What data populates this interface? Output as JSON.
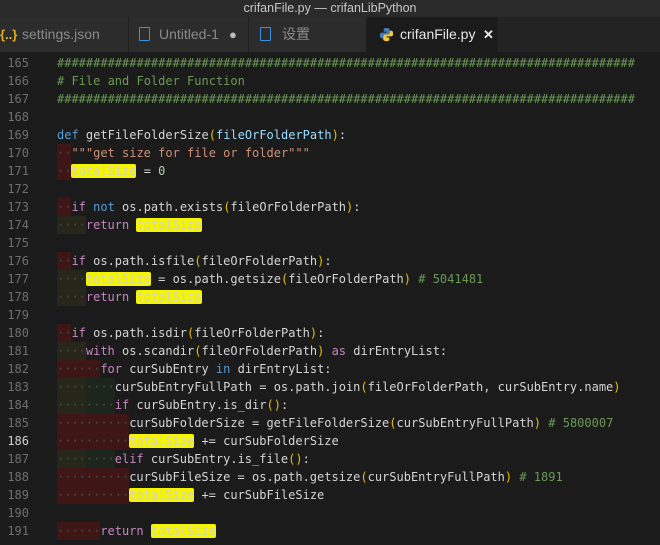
{
  "window": {
    "title": "crifanFile.py — crifanLibPython"
  },
  "tabs": [
    {
      "label": "settings.json",
      "icon": "json-braces-icon",
      "active": false
    },
    {
      "label": "Untitled-1",
      "icon": "file-icon",
      "active": false,
      "dirty": true,
      "dirty_glyph": "●"
    },
    {
      "label": "设置",
      "icon": "file-icon",
      "active": false
    },
    {
      "label": "crifanFile.py",
      "icon": "python-icon",
      "active": true,
      "close_glyph": "✕"
    }
  ],
  "colors": {
    "highlight": "#f5f500",
    "keyword": "#569cd6",
    "control": "#c586c0",
    "comment": "#6a9955",
    "string": "#ce9178",
    "indent_error": "#3e1616"
  },
  "editor": {
    "current_line": 186,
    "lines": [
      {
        "no": 165,
        "indent": [],
        "tokens": [
          [
            "c",
            "################################################################################"
          ]
        ]
      },
      {
        "no": 166,
        "indent": [],
        "tokens": [
          [
            "c",
            "# File and Folder Function"
          ]
        ]
      },
      {
        "no": 167,
        "indent": [],
        "tokens": [
          [
            "c",
            "################################################################################"
          ]
        ]
      },
      {
        "no": 168,
        "indent": [],
        "tokens": []
      },
      {
        "no": 169,
        "indent": [],
        "tokens": [
          [
            "kw",
            "def"
          ],
          [
            "t",
            " "
          ],
          [
            "fn",
            "getFileFolderSize"
          ],
          [
            "p",
            "("
          ],
          [
            "var",
            "fileOrFolderPath"
          ],
          [
            "p",
            ")"
          ],
          [
            "t",
            ":"
          ]
        ]
      },
      {
        "no": 170,
        "indent": [
          [
            "err",
            2
          ]
        ],
        "tokens": [
          [
            "s",
            "\"\"\"get size for file or folder\"\"\""
          ]
        ]
      },
      {
        "no": 171,
        "indent": [
          [
            "err",
            2
          ]
        ],
        "tokens": [
          [
            "hl",
            "totalSize"
          ],
          [
            "t",
            " = "
          ],
          [
            "n",
            "0"
          ]
        ]
      },
      {
        "no": 172,
        "indent": [],
        "tokens": []
      },
      {
        "no": 173,
        "indent": [
          [
            "err",
            2
          ]
        ],
        "tokens": [
          [
            "ctl",
            "if"
          ],
          [
            "t",
            " "
          ],
          [
            "kw",
            "not"
          ],
          [
            "t",
            " os.path.exists"
          ],
          [
            "p",
            "("
          ],
          [
            "t",
            "fileOrFolderPath"
          ],
          [
            "p",
            ")"
          ],
          [
            "t",
            ":"
          ]
        ]
      },
      {
        "no": 174,
        "indent": [
          [
            "l1",
            4
          ]
        ],
        "tokens": [
          [
            "ctl",
            "return"
          ],
          [
            "t",
            " "
          ],
          [
            "hl",
            "totalSize"
          ]
        ]
      },
      {
        "no": 175,
        "indent": [],
        "tokens": []
      },
      {
        "no": 176,
        "indent": [
          [
            "err",
            2
          ]
        ],
        "tokens": [
          [
            "ctl",
            "if"
          ],
          [
            "t",
            " os.path.isfile"
          ],
          [
            "p",
            "("
          ],
          [
            "t",
            "fileOrFolderPath"
          ],
          [
            "p",
            ")"
          ],
          [
            "t",
            ":"
          ]
        ]
      },
      {
        "no": 177,
        "indent": [
          [
            "l1",
            4
          ]
        ],
        "tokens": [
          [
            "hl",
            "totalSize"
          ],
          [
            "t",
            " = os.path.getsize"
          ],
          [
            "p",
            "("
          ],
          [
            "t",
            "fileOrFolderPath"
          ],
          [
            "p",
            ")"
          ],
          [
            "t",
            " "
          ],
          [
            "c",
            "# 5041481"
          ]
        ]
      },
      {
        "no": 178,
        "indent": [
          [
            "l1",
            4
          ]
        ],
        "tokens": [
          [
            "ctl",
            "return"
          ],
          [
            "t",
            " "
          ],
          [
            "hl",
            "totalSize"
          ]
        ]
      },
      {
        "no": 179,
        "indent": [],
        "tokens": []
      },
      {
        "no": 180,
        "indent": [
          [
            "err",
            2
          ]
        ],
        "tokens": [
          [
            "ctl",
            "if"
          ],
          [
            "t",
            " os.path.isdir"
          ],
          [
            "p",
            "("
          ],
          [
            "t",
            "fileOrFolderPath"
          ],
          [
            "p",
            ")"
          ],
          [
            "t",
            ":"
          ]
        ]
      },
      {
        "no": 181,
        "indent": [
          [
            "l1",
            4
          ]
        ],
        "tokens": [
          [
            "ctl",
            "with"
          ],
          [
            "t",
            " os.scandir"
          ],
          [
            "p",
            "("
          ],
          [
            "t",
            "fileOrFolderPath"
          ],
          [
            "p",
            ")"
          ],
          [
            "t",
            " "
          ],
          [
            "ctl",
            "as"
          ],
          [
            "t",
            " dirEntryList:"
          ]
        ]
      },
      {
        "no": 182,
        "indent": [
          [
            "err",
            6
          ]
        ],
        "tokens": [
          [
            "ctl",
            "for"
          ],
          [
            "t",
            " curSubEntry "
          ],
          [
            "kw",
            "in"
          ],
          [
            "t",
            " dirEntryList:"
          ]
        ]
      },
      {
        "no": 183,
        "indent": [
          [
            "l1",
            4
          ],
          [
            "l2",
            4
          ]
        ],
        "tokens": [
          [
            "t",
            "curSubEntryFullPath = os.path.join"
          ],
          [
            "p",
            "("
          ],
          [
            "t",
            "fileOrFolderPath, curSubEntry.name"
          ],
          [
            "p",
            ")"
          ]
        ]
      },
      {
        "no": 184,
        "indent": [
          [
            "l1",
            4
          ],
          [
            "l2",
            4
          ]
        ],
        "tokens": [
          [
            "ctl",
            "if"
          ],
          [
            "t",
            " curSubEntry.is_dir"
          ],
          [
            "p",
            "()"
          ],
          [
            "t",
            ":"
          ]
        ]
      },
      {
        "no": 185,
        "indent": [
          [
            "err",
            10
          ]
        ],
        "tokens": [
          [
            "t",
            "curSubFolderSize = getFileFolderSize"
          ],
          [
            "p",
            "("
          ],
          [
            "t",
            "curSubEntryFullPath"
          ],
          [
            "p",
            ")"
          ],
          [
            "t",
            " "
          ],
          [
            "c",
            "# 5800007"
          ]
        ]
      },
      {
        "no": 186,
        "indent": [
          [
            "err",
            10
          ]
        ],
        "tokens": [
          [
            "hl",
            "totalSize"
          ],
          [
            "t",
            " += curSubFolderSize"
          ]
        ]
      },
      {
        "no": 187,
        "indent": [
          [
            "l1",
            4
          ],
          [
            "l2",
            4
          ]
        ],
        "tokens": [
          [
            "ctl",
            "elif"
          ],
          [
            "t",
            " curSubEntry.is_file"
          ],
          [
            "p",
            "()"
          ],
          [
            "t",
            ":"
          ]
        ]
      },
      {
        "no": 188,
        "indent": [
          [
            "err",
            10
          ]
        ],
        "tokens": [
          [
            "t",
            "curSubFileSize = os.path.getsize"
          ],
          [
            "p",
            "("
          ],
          [
            "t",
            "curSubEntryFullPath"
          ],
          [
            "p",
            ")"
          ],
          [
            "t",
            " "
          ],
          [
            "c",
            "# 1891"
          ]
        ]
      },
      {
        "no": 189,
        "indent": [
          [
            "err",
            10
          ]
        ],
        "tokens": [
          [
            "hl",
            "totalSize"
          ],
          [
            "t",
            " += curSubFileSize"
          ]
        ]
      },
      {
        "no": 190,
        "indent": [],
        "tokens": []
      },
      {
        "no": 191,
        "indent": [
          [
            "err",
            6
          ]
        ],
        "tokens": [
          [
            "ctl",
            "return"
          ],
          [
            "t",
            " "
          ],
          [
            "hl",
            "totalSize"
          ]
        ]
      }
    ]
  }
}
